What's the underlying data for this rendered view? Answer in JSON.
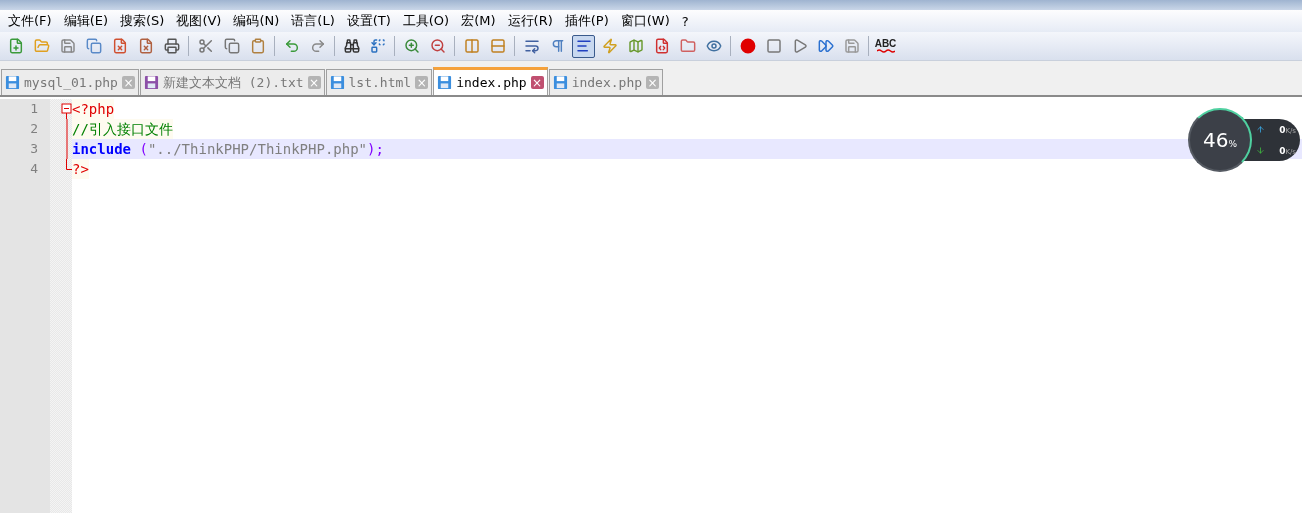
{
  "menu": [
    "文件(F)",
    "编辑(E)",
    "搜索(S)",
    "视图(V)",
    "编码(N)",
    "语言(L)",
    "设置(T)",
    "工具(O)",
    "宏(M)",
    "运行(R)",
    "插件(P)",
    "窗口(W)",
    "?"
  ],
  "toolbar": [
    {
      "kind": "new",
      "pressed": false
    },
    {
      "kind": "open",
      "pressed": false
    },
    {
      "kind": "save",
      "pressed": false
    },
    {
      "kind": "save-all",
      "pressed": false
    },
    {
      "kind": "close",
      "pressed": false
    },
    {
      "kind": "close-all",
      "pressed": false
    },
    {
      "kind": "print",
      "pressed": false
    },
    {
      "kind": "sep"
    },
    {
      "kind": "cut",
      "pressed": false
    },
    {
      "kind": "copy",
      "pressed": false
    },
    {
      "kind": "paste",
      "pressed": false
    },
    {
      "kind": "sep"
    },
    {
      "kind": "undo",
      "pressed": false
    },
    {
      "kind": "redo",
      "pressed": false
    },
    {
      "kind": "sep"
    },
    {
      "kind": "find",
      "pressed": false
    },
    {
      "kind": "replace",
      "pressed": false
    },
    {
      "kind": "sep"
    },
    {
      "kind": "zoom-in",
      "pressed": false
    },
    {
      "kind": "zoom-out",
      "pressed": false
    },
    {
      "kind": "sep"
    },
    {
      "kind": "sync-v",
      "pressed": false
    },
    {
      "kind": "sync-h",
      "pressed": false
    },
    {
      "kind": "sep"
    },
    {
      "kind": "wrap",
      "pressed": false
    },
    {
      "kind": "pilcrow",
      "pressed": false
    },
    {
      "kind": "indent-guide",
      "pressed": true
    },
    {
      "kind": "lang",
      "pressed": false
    },
    {
      "kind": "map",
      "pressed": false
    },
    {
      "kind": "func",
      "pressed": false
    },
    {
      "kind": "folder",
      "pressed": false
    },
    {
      "kind": "eye",
      "pressed": false
    },
    {
      "kind": "sep"
    },
    {
      "kind": "record",
      "pressed": false
    },
    {
      "kind": "stop",
      "pressed": false
    },
    {
      "kind": "play",
      "pressed": false
    },
    {
      "kind": "play-multi",
      "pressed": false
    },
    {
      "kind": "save-macro",
      "pressed": false
    },
    {
      "kind": "sep"
    },
    {
      "kind": "spell"
    }
  ],
  "spell_label": "ABC",
  "tabs": [
    {
      "label": "mysql_01.php",
      "selected": false,
      "color": "#3b8ede"
    },
    {
      "label": "新建文本文档 (2).txt",
      "selected": false,
      "color": "#8c4fa8"
    },
    {
      "label": "lst.html",
      "selected": false,
      "color": "#3b8ede"
    },
    {
      "label": "index.php",
      "selected": true,
      "color": "#3b8ede"
    },
    {
      "label": "index.php",
      "selected": false,
      "color": "#3b8ede"
    }
  ],
  "close_glyph": "×",
  "editor": {
    "lines": [
      {
        "number": "1",
        "fold_header": true,
        "fold_end": false,
        "current": false,
        "tokens": [
          {
            "kind": "tag",
            "text": "<?php"
          }
        ]
      },
      {
        "number": "2",
        "fold_header": false,
        "fold_end": false,
        "current": false,
        "tokens": [
          {
            "kind": "comment",
            "text": "//引入接口文件"
          }
        ]
      },
      {
        "number": "3",
        "fold_header": false,
        "fold_end": false,
        "current": true,
        "tokens": [
          {
            "kind": "keyword",
            "text": "include"
          },
          {
            "kind": "paren",
            "text": " ("
          },
          {
            "kind": "string",
            "text": "\"../ThinkPHP/ThinkPHP.php\""
          },
          {
            "kind": "paren",
            "text": ");"
          }
        ]
      },
      {
        "number": "4",
        "fold_header": false,
        "fold_end": true,
        "current": false,
        "tokens": [
          {
            "kind": "tag",
            "text": "?>"
          }
        ]
      }
    ]
  },
  "net_monitor": {
    "percent": "46",
    "percent_sign": "%",
    "upload": "0",
    "download": "0",
    "unit_up": "K/s",
    "unit_down": "K/s"
  }
}
